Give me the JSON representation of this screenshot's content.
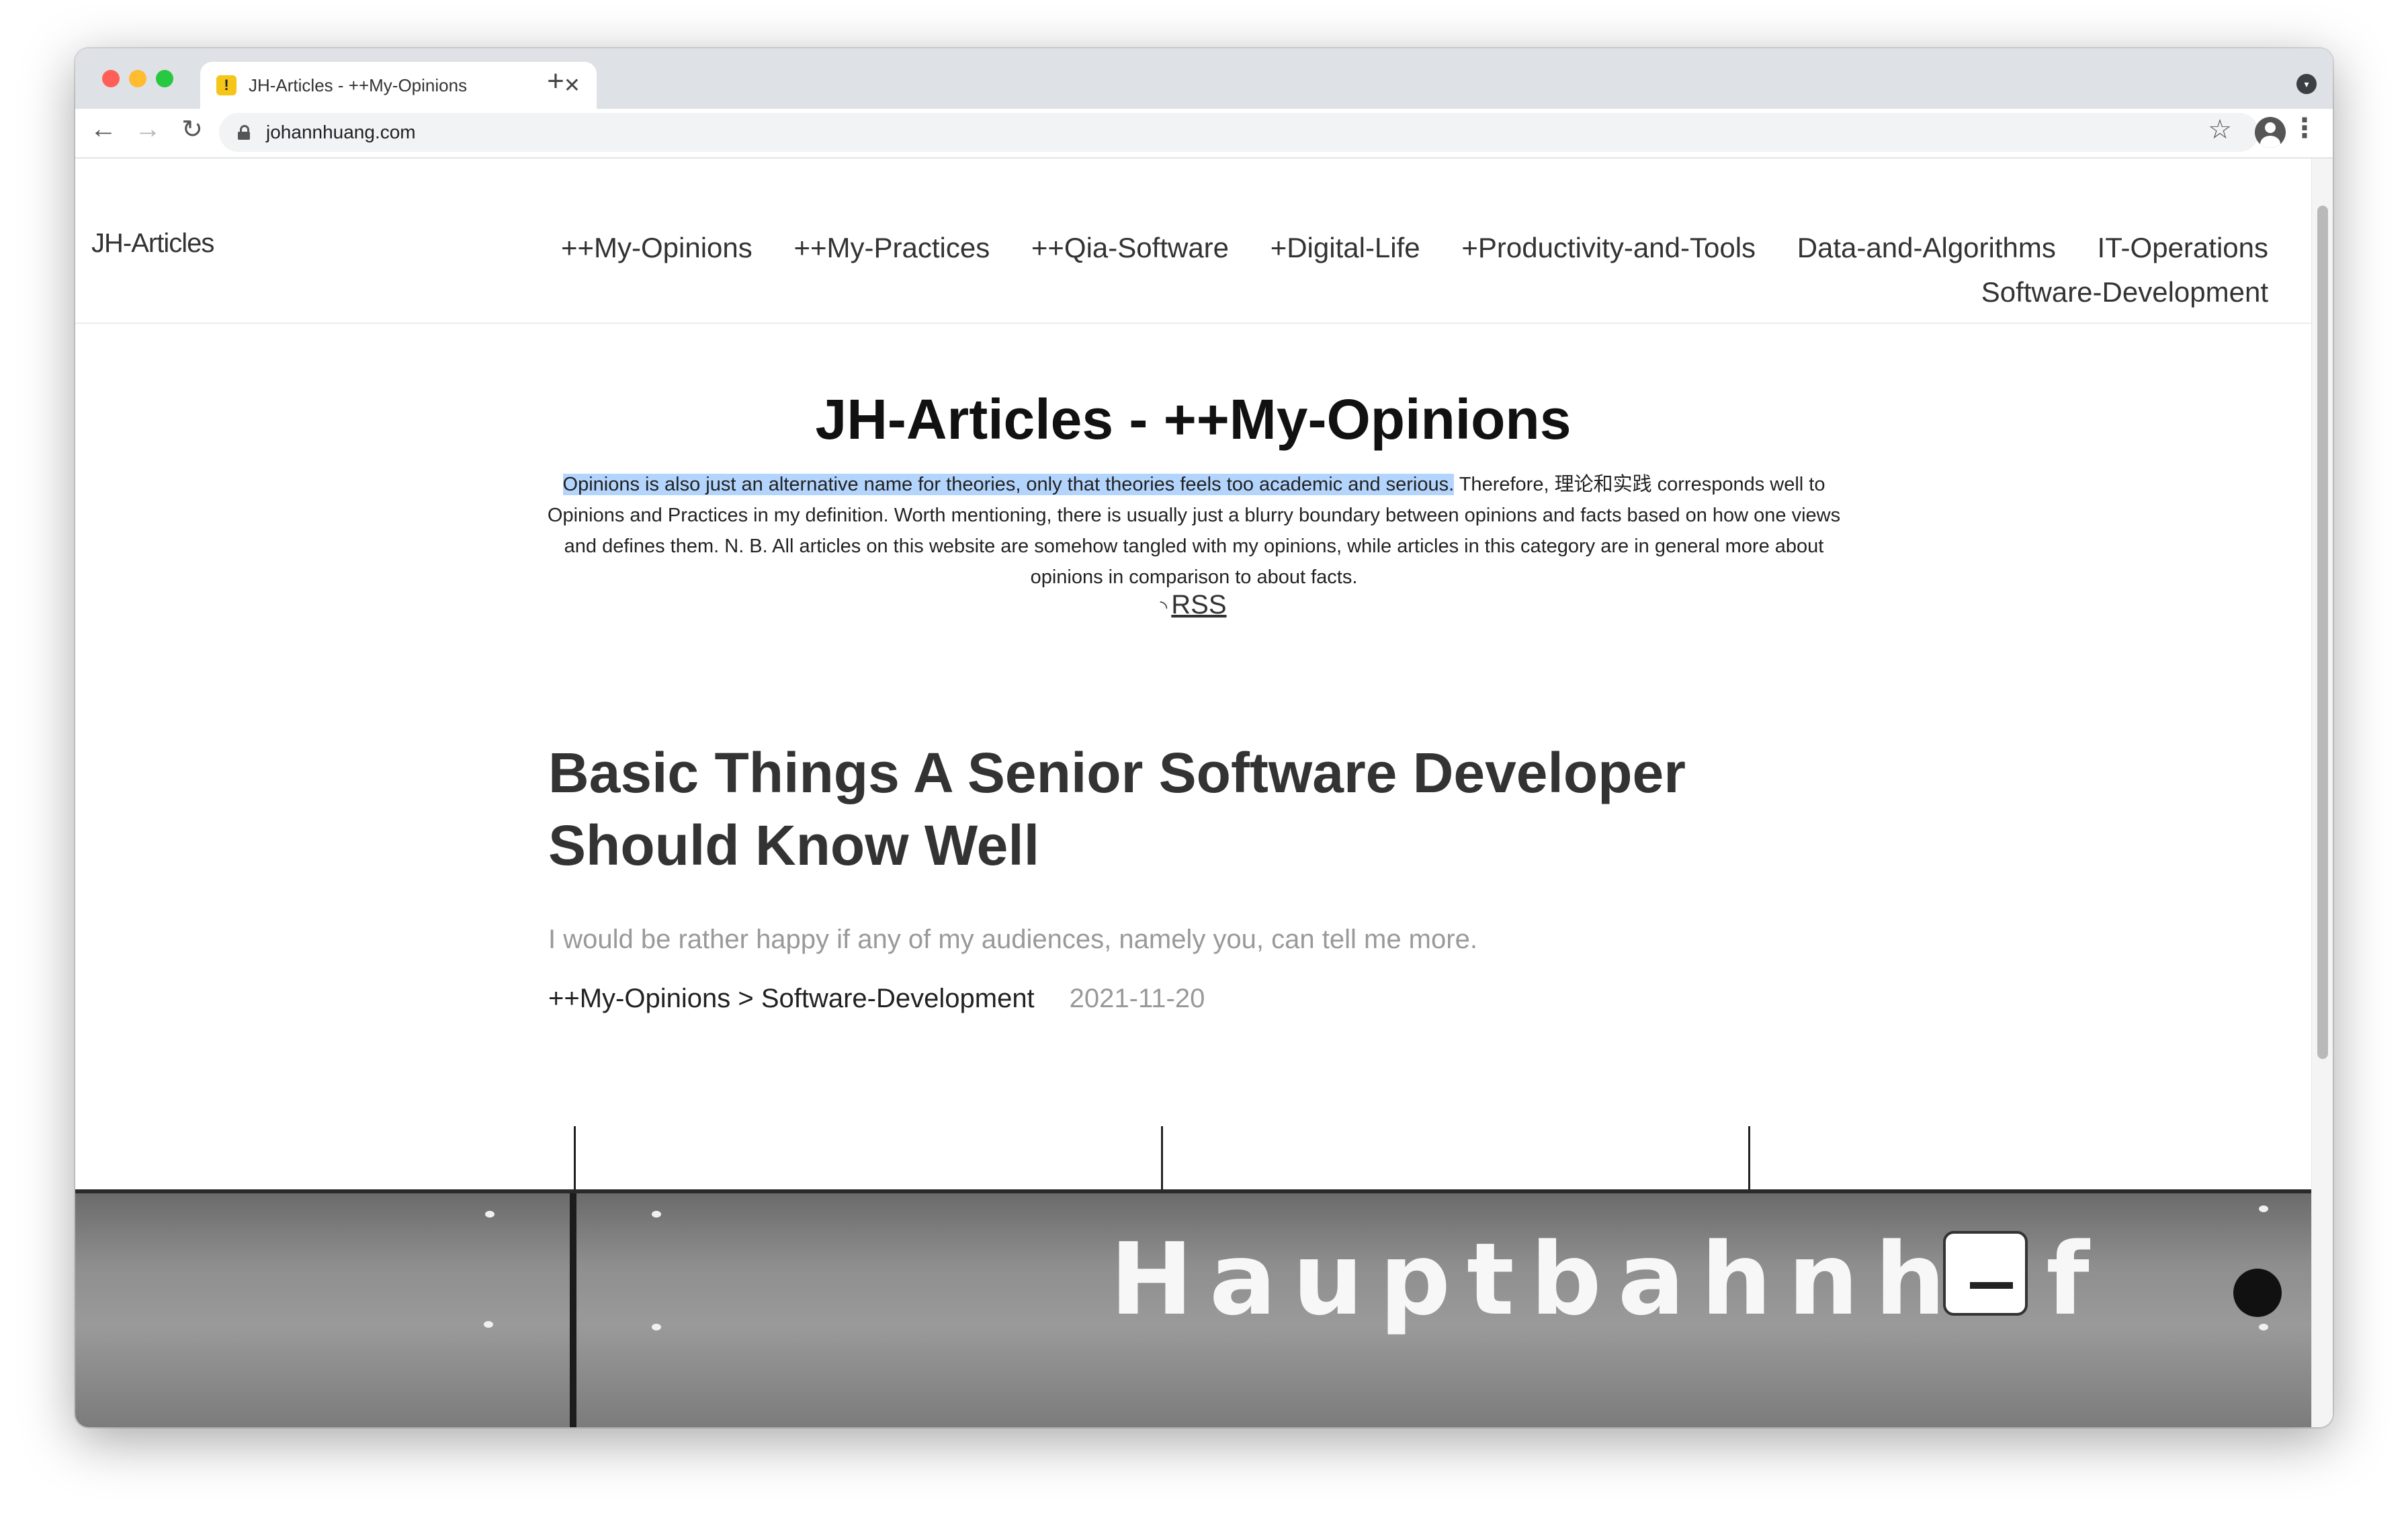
{
  "browser": {
    "tab_title": "JH-Articles - ++My-Opinions",
    "favicon_glyph": "!",
    "new_tab_glyph": "+",
    "close_glyph": "✕",
    "url": "johannhuang.com",
    "icons": [
      "back-icon",
      "forward-icon",
      "reload-icon",
      "lock-icon",
      "star-icon",
      "profile-icon",
      "menu-icon"
    ]
  },
  "site": {
    "brand": "JH-Articles",
    "nav": [
      "++My-Opinions",
      "++My-Practices",
      "++Qia-Software",
      "+Digital-Life",
      "+Productivity-and-Tools",
      "Data-and-Algorithms",
      "IT-Operations",
      "Software-Development"
    ]
  },
  "header": {
    "title": "JH-Articles - ++My-Opinions",
    "description_highlighted": "Opinions is also just an alternative name for theories, only that theories feels too academic and serious.",
    "description_rest": " Therefore, 理论和实践 corresponds well to Opinions and Practices in my definition. Worth mentioning, there is usually just a blurry boundary between opinions and facts based on how one views and defines them. N. B. All articles on this website are somehow tangled with my opinions, while articles in this category are in general more about opinions in comparison to about facts.",
    "rss_label": "RSS"
  },
  "post": {
    "title": "Basic Things A Senior Software Developer Should Know Well",
    "subtitle": "I would be rather happy if any of my audiences, namely you, can tell me more.",
    "breadcrumb": "++My-Opinions > Software-Development",
    "date": "2021-11-20"
  },
  "banner": {
    "sign_text": "Hauptbahnhof"
  },
  "colors": {
    "highlight": "#b3d4fc",
    "tab_strip": "#dee1e6",
    "muted_text": "#999999"
  }
}
